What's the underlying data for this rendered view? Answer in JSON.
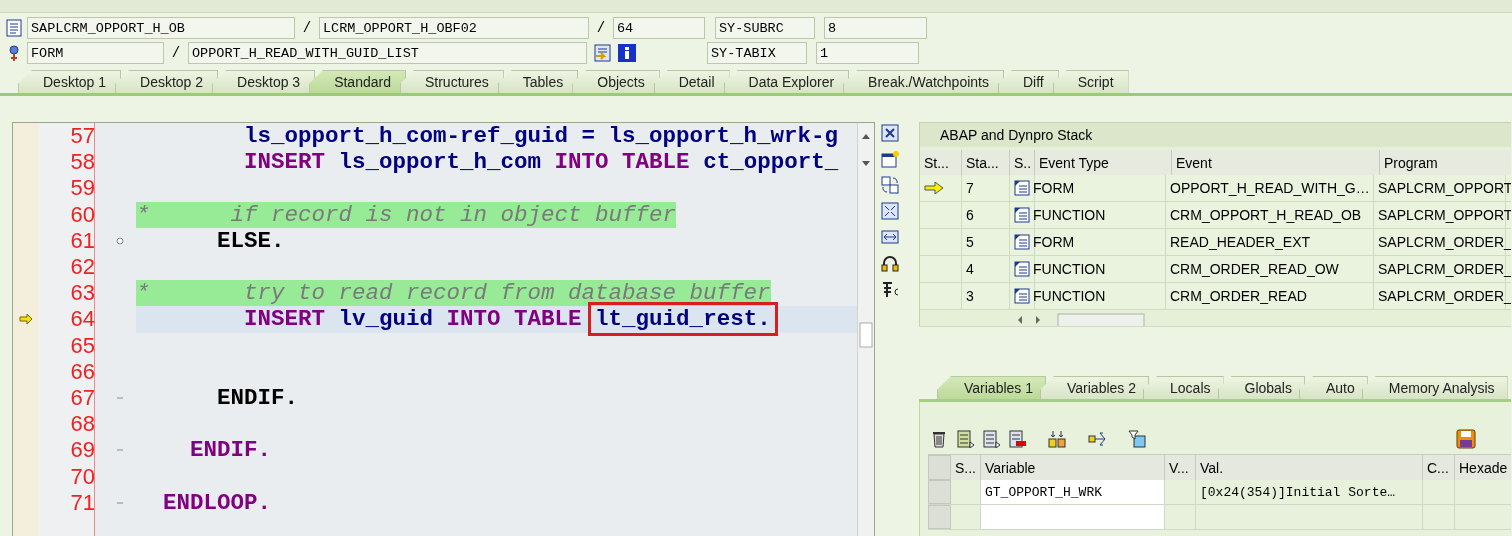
{
  "context": {
    "program": "SAPLCRM_OPPORT_H_OB",
    "include": "LCRM_OPPORT_H_OBF02",
    "line": "64",
    "event_type": "FORM",
    "event": "OPPORT_H_READ_WITH_GUID_LIST",
    "separators": [
      "/",
      "/",
      "/"
    ],
    "system_fields": [
      {
        "name": "SY-SUBRC",
        "value": "8"
      },
      {
        "name": "SY-TABIX",
        "value": "1"
      }
    ]
  },
  "tabs": [
    {
      "label": "Desktop 1",
      "selected": false
    },
    {
      "label": "Desktop 2",
      "selected": false
    },
    {
      "label": "Desktop 3",
      "selected": false
    },
    {
      "label": "Standard",
      "selected": true
    },
    {
      "label": "Structures",
      "selected": false
    },
    {
      "label": "Tables",
      "selected": false
    },
    {
      "label": "Objects",
      "selected": false
    },
    {
      "label": "Detail",
      "selected": false
    },
    {
      "label": "Data Explorer",
      "selected": false
    },
    {
      "label": "Break./Watchpoints",
      "selected": false
    },
    {
      "label": "Diff",
      "selected": false
    },
    {
      "label": "Script",
      "selected": false
    }
  ],
  "editor": {
    "lines": [
      {
        "number": "57",
        "current": false,
        "tokens": [
          {
            "kind": "identifier",
            "text": "        ls_opport_h_com-ref_guid = ls_opport_h_wrk-g"
          }
        ]
      },
      {
        "number": "58",
        "current": false,
        "tokens": [
          {
            "kind": "keyword",
            "text": "        INSERT "
          },
          {
            "kind": "identifier",
            "text": "ls_opport_h_com "
          },
          {
            "kind": "keyword",
            "text": "INTO TABLE "
          },
          {
            "kind": "identifier",
            "text": "ct_opport_"
          }
        ]
      },
      {
        "number": "59",
        "current": false
      },
      {
        "number": "60",
        "current": false,
        "tokens": [
          {
            "kind": "comment",
            "text": "*      if record is not in object buffer"
          }
        ]
      },
      {
        "number": "61",
        "current": false,
        "fold_branch": true,
        "tokens": [
          {
            "kind": "plain",
            "text": "      ELSE."
          }
        ]
      },
      {
        "number": "62",
        "current": false
      },
      {
        "number": "63",
        "current": false,
        "tokens": [
          {
            "kind": "comment",
            "text": "*       try to read record from database buffer"
          }
        ]
      },
      {
        "number": "64",
        "current": true,
        "tokens": [
          {
            "kind": "keyword",
            "text": "        INSERT "
          },
          {
            "kind": "identifier",
            "text": "lv_guid "
          },
          {
            "kind": "keyword",
            "text": "INTO TABLE "
          },
          {
            "kind": "identifier",
            "text": "lt_guid_rest.",
            "boxed": true
          }
        ]
      },
      {
        "number": "65",
        "current": false
      },
      {
        "number": "66",
        "current": false
      },
      {
        "number": "67",
        "current": false,
        "fold_end": true,
        "tokens": [
          {
            "kind": "plain",
            "text": "      ENDIF."
          }
        ]
      },
      {
        "number": "68",
        "current": false
      },
      {
        "number": "69",
        "current": false,
        "fold_end": true,
        "tokens": [
          {
            "kind": "keyword",
            "text": "    ENDIF."
          }
        ]
      },
      {
        "number": "70",
        "current": false
      },
      {
        "number": "71",
        "current": false,
        "fold_end": true,
        "tokens": [
          {
            "kind": "keyword",
            "text": "  ENDLOOP."
          }
        ]
      }
    ]
  },
  "stack": {
    "title": "ABAP and Dynpro Stack",
    "columns": [
      "St...",
      "Sta...",
      "S..",
      "Event Type",
      "Event",
      "Program"
    ],
    "rows": [
      {
        "current": true,
        "stack_level": "7",
        "event_type": "FORM",
        "event": "OPPORT_H_READ_WITH_G…",
        "program": "SAPLCRM_OPPORT"
      },
      {
        "current": false,
        "stack_level": "6",
        "event_type": "FUNCTION",
        "event": "CRM_OPPORT_H_READ_OB",
        "program": "SAPLCRM_OPPORT"
      },
      {
        "current": false,
        "stack_level": "5",
        "event_type": "FORM",
        "event": "READ_HEADER_EXT",
        "program": "SAPLCRM_ORDER_"
      },
      {
        "current": false,
        "stack_level": "4",
        "event_type": "FUNCTION",
        "event": "CRM_ORDER_READ_OW",
        "program": "SAPLCRM_ORDER_"
      },
      {
        "current": false,
        "stack_level": "3",
        "event_type": "FUNCTION",
        "event": "CRM_ORDER_READ",
        "program": "SAPLCRM_ORDER_"
      }
    ]
  },
  "variables": {
    "tabs": [
      {
        "label": "Variables 1",
        "selected": true
      },
      {
        "label": "Variables 2",
        "selected": false
      },
      {
        "label": "Locals",
        "selected": false
      },
      {
        "label": "Globals",
        "selected": false
      },
      {
        "label": "Auto",
        "selected": false
      },
      {
        "label": "Memory Analysis",
        "selected": false
      }
    ],
    "columns": [
      "S...",
      "Variable",
      "V...",
      "Val.",
      "C...",
      "Hexade"
    ],
    "rows": [
      {
        "variable": "GT_OPPORT_H_WRK",
        "value": "[0x24(354)]Initial Sorte…"
      }
    ]
  }
}
